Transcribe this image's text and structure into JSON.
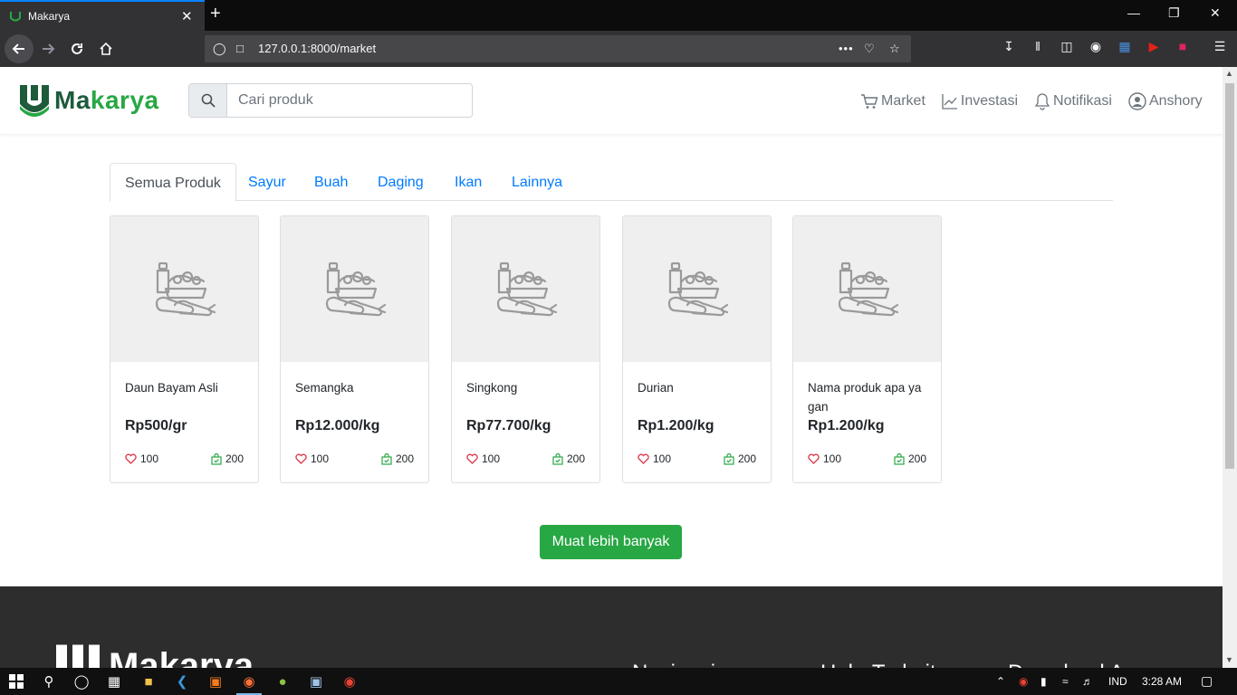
{
  "browser": {
    "tab_title": "Makarya",
    "tab_close": "✕",
    "new_tab": "+",
    "url": "127.0.0.1:8000/market"
  },
  "header": {
    "brand_prefix": "Ma",
    "brand_suffix": "karya",
    "search_placeholder": "Cari produk",
    "nav": [
      {
        "label": "Market",
        "icon": "cart-icon"
      },
      {
        "label": "Investasi",
        "icon": "chart-line-icon"
      },
      {
        "label": "Notifikasi",
        "icon": "bell-icon"
      },
      {
        "label": "Anshory",
        "icon": "user-circle-icon"
      }
    ]
  },
  "tabs": [
    "Semua Produk",
    "Sayur",
    "Buah",
    "Daging",
    "Ikan",
    "Lainnya"
  ],
  "products": [
    {
      "name": "Daun Bayam Asli",
      "price": "Rp500/gr",
      "likes": "100",
      "sold": "200"
    },
    {
      "name": "Semangka",
      "price": "Rp12.000/kg",
      "likes": "100",
      "sold": "200"
    },
    {
      "name": "Singkong",
      "price": "Rp77.700/kg",
      "likes": "100",
      "sold": "200"
    },
    {
      "name": "Durian",
      "price": "Rp1.200/kg",
      "likes": "100",
      "sold": "200"
    },
    {
      "name": "Nama produk apa ya gan",
      "price": "Rp1.200/kg",
      "likes": "100",
      "sold": "200"
    }
  ],
  "load_more": "Muat lebih banyak",
  "footer": {
    "brand": "Makarya",
    "headings": [
      "Navigasi",
      "Hub. Terkait",
      "Download A..."
    ]
  },
  "taskbar": {
    "language": "IND",
    "time": "3:28 AM"
  },
  "colors": {
    "brand_green": "#28a745",
    "brand_dark": "#1d5b3b",
    "link_blue": "#007bff",
    "footer_bg": "#2d2d2d"
  }
}
